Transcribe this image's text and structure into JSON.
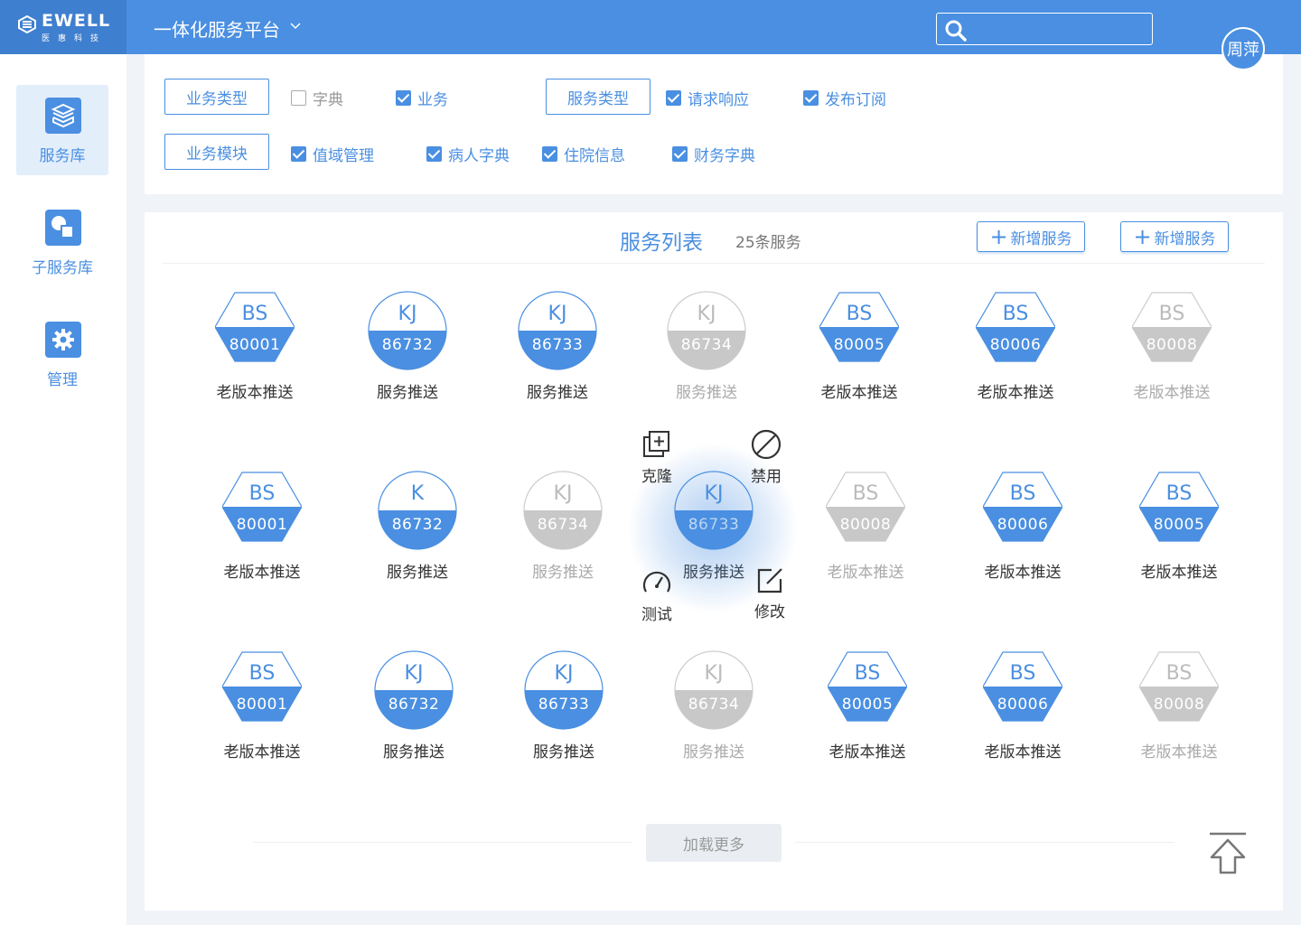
{
  "header": {
    "logo_text": "EWELL",
    "logo_sub": "医惠科技",
    "platform_title": "一体化服务平台",
    "search_placeholder": "",
    "user_name": "周萍"
  },
  "sidebar": {
    "items": [
      {
        "label": "服务库",
        "icon": "cube-icon",
        "active": true
      },
      {
        "label": "子服务库",
        "icon": "shapes-icon",
        "active": false
      },
      {
        "label": "管理",
        "icon": "gear-icon",
        "active": false
      }
    ]
  },
  "filters": {
    "service_type_btn": "业务类型",
    "service_type2_btn": "服务类型",
    "module_btn": "业务模块",
    "row1": [
      {
        "label": "字典",
        "checked": false
      },
      {
        "label": "业务",
        "checked": true
      },
      {
        "label": "请求响应",
        "checked": true
      },
      {
        "label": "发布订阅",
        "checked": true
      }
    ],
    "row2": [
      {
        "label": "值域管理",
        "checked": true
      },
      {
        "label": "病人字典",
        "checked": true
      },
      {
        "label": "住院信息",
        "checked": true
      },
      {
        "label": "财务字典",
        "checked": true
      }
    ]
  },
  "list": {
    "title": "服务列表",
    "count": "25条服务",
    "add_btn_1": "新增服务",
    "add_btn_2": "新增服务",
    "load_more": "加载更多",
    "rows": [
      [
        {
          "shape": "hex",
          "code": "BS",
          "num": "80001",
          "label": "老版本推送",
          "disabled": false
        },
        {
          "shape": "circle",
          "code": "KJ",
          "num": "86732",
          "label": "服务推送",
          "disabled": false
        },
        {
          "shape": "circle",
          "code": "KJ",
          "num": "86733",
          "label": "服务推送",
          "disabled": false
        },
        {
          "shape": "circle",
          "code": "KJ",
          "num": "86734",
          "label": "服务推送",
          "disabled": true
        },
        {
          "shape": "hex",
          "code": "BS",
          "num": "80005",
          "label": "老版本推送",
          "disabled": false
        },
        {
          "shape": "hex",
          "code": "BS",
          "num": "80006",
          "label": "老版本推送",
          "disabled": false
        },
        {
          "shape": "hex",
          "code": "BS",
          "num": "80008",
          "label": "老版本推送",
          "disabled": true
        }
      ],
      [
        {
          "shape": "hex",
          "code": "BS",
          "num": "80001",
          "label": "老版本推送",
          "disabled": false
        },
        {
          "shape": "circle",
          "code": "K",
          "num": "86732",
          "label": "服务推送",
          "disabled": false
        },
        {
          "shape": "circle",
          "code": "KJ",
          "num": "86734",
          "label": "服务推送",
          "disabled": true
        },
        {
          "shape": "circle",
          "code": "KJ",
          "num": "86733",
          "label": "服务推送",
          "disabled": false,
          "focused": true
        },
        {
          "shape": "hex",
          "code": "BS",
          "num": "80008",
          "label": "老版本推送",
          "disabled": true
        },
        {
          "shape": "hex",
          "code": "BS",
          "num": "80006",
          "label": "老版本推送",
          "disabled": false
        },
        {
          "shape": "hex",
          "code": "BS",
          "num": "80005",
          "label": "老版本推送",
          "disabled": false
        }
      ],
      [
        {
          "shape": "hex",
          "code": "BS",
          "num": "80001",
          "label": "老版本推送",
          "disabled": false
        },
        {
          "shape": "circle",
          "code": "KJ",
          "num": "86732",
          "label": "服务推送",
          "disabled": false
        },
        {
          "shape": "circle",
          "code": "KJ",
          "num": "86733",
          "label": "服务推送",
          "disabled": false
        },
        {
          "shape": "circle",
          "code": "KJ",
          "num": "86734",
          "label": "服务推送",
          "disabled": true
        },
        {
          "shape": "hex",
          "code": "BS",
          "num": "80005",
          "label": "老版本推送",
          "disabled": false
        },
        {
          "shape": "hex",
          "code": "BS",
          "num": "80006",
          "label": "老版本推送",
          "disabled": false
        },
        {
          "shape": "hex",
          "code": "BS",
          "num": "80008",
          "label": "老版本推送",
          "disabled": true
        }
      ]
    ],
    "actions": {
      "clone": "克隆",
      "disable": "禁用",
      "test": "测试",
      "edit": "修改"
    }
  },
  "colors": {
    "primary": "#4a8fe1",
    "disabled": "#c8c8c8"
  }
}
